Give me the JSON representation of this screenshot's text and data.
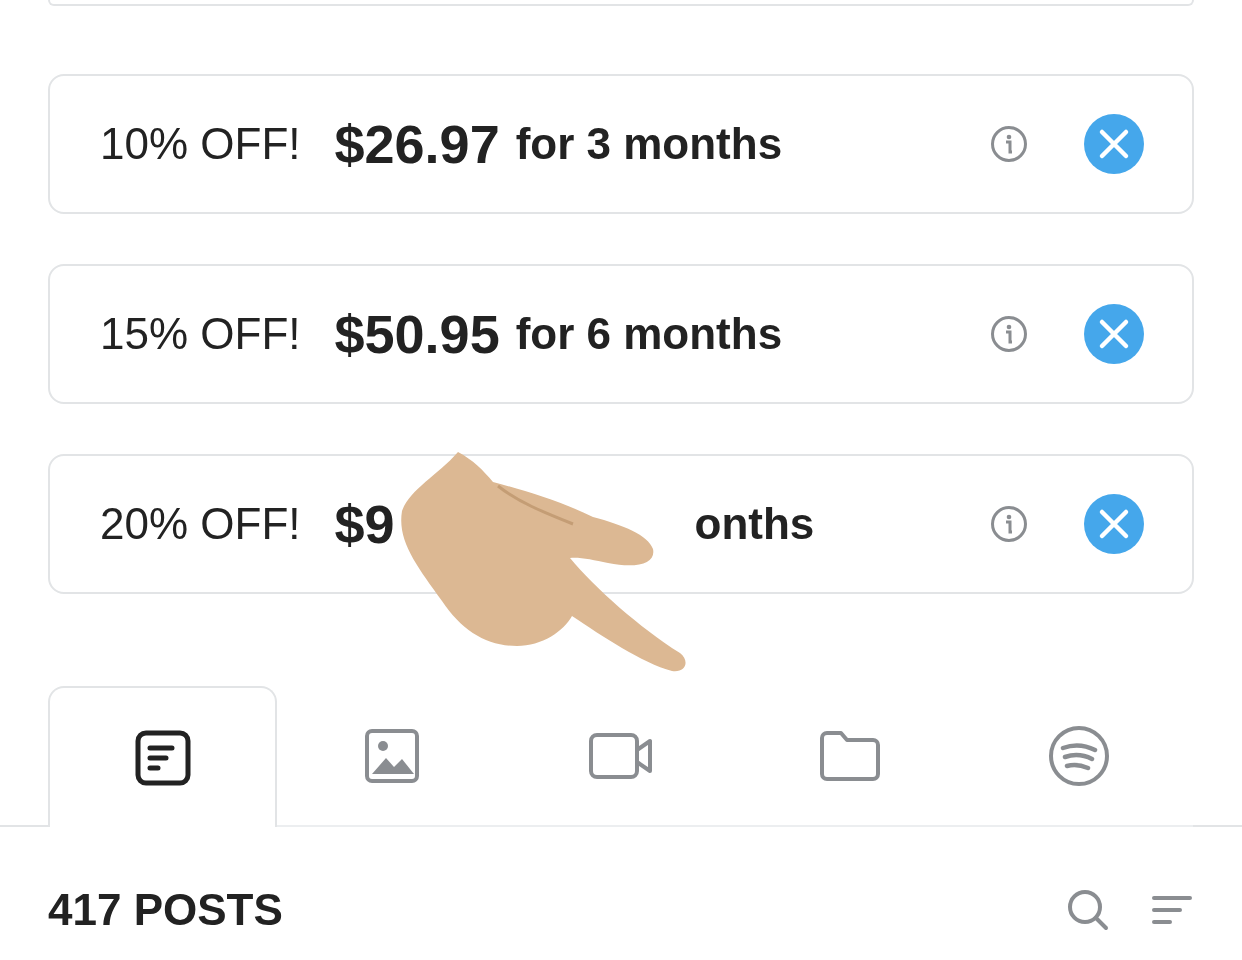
{
  "bundles": [
    {
      "discount": "10% OFF!",
      "price": "$26.97",
      "period": "for 3 months"
    },
    {
      "discount": "15% OFF!",
      "price": "$50.95",
      "period": "for 6 months"
    },
    {
      "discount": "20% OFF!",
      "price": "$9",
      "period": "onths",
      "covered": true
    }
  ],
  "tabs": [
    {
      "selected": true
    },
    {
      "selected": false
    },
    {
      "selected": false
    },
    {
      "selected": false
    },
    {
      "selected": false
    }
  ],
  "posts_count": "417 POSTS"
}
